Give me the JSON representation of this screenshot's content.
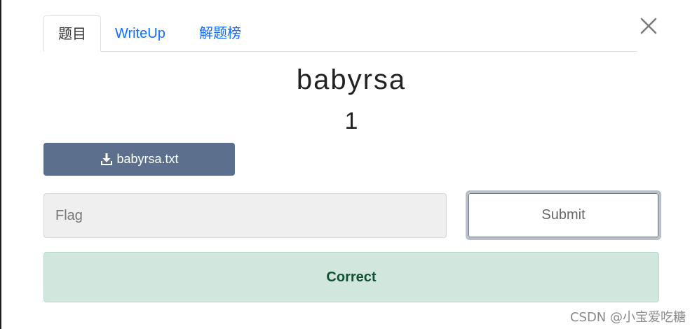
{
  "tabs": [
    {
      "label": "题目",
      "active": true
    },
    {
      "label": "WriteUp",
      "active": false
    },
    {
      "label": "解题榜",
      "active": false
    }
  ],
  "close": {
    "icon": "close-icon"
  },
  "challenge": {
    "name": "babyrsa",
    "points": "1"
  },
  "download": {
    "icon": "download-icon",
    "label": "babyrsa.txt"
  },
  "flag_input": {
    "placeholder": "Flag",
    "value": ""
  },
  "submit": {
    "label": "Submit"
  },
  "result": {
    "message": "Correct",
    "status": "success"
  },
  "watermark": {
    "text": "CSDN @小宝爱吃糖"
  },
  "colors": {
    "tab_link": "#0d6efd",
    "download_bg": "#5c708e",
    "success_bg": "#d1e7dd",
    "success_text": "#0f5132"
  }
}
